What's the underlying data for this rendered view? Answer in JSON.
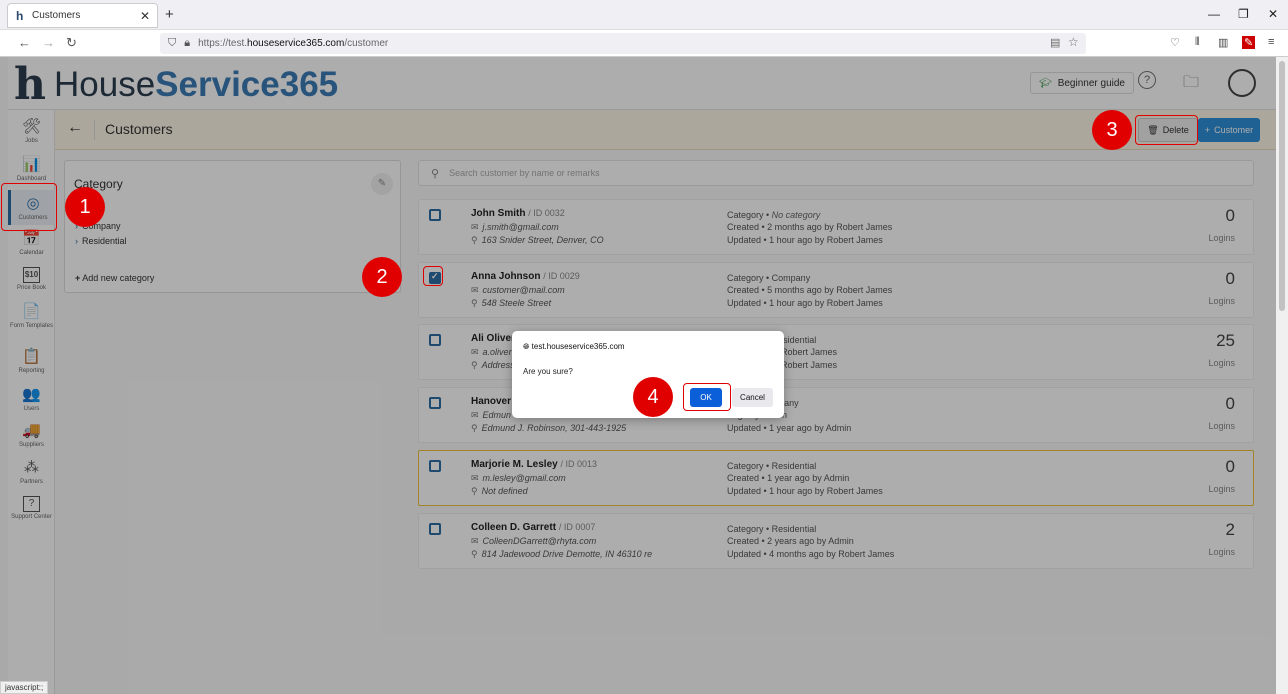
{
  "browser": {
    "tab_title": "Customers",
    "url_prefix": "https://test.",
    "url_domain": "houseservice365.com",
    "url_path": "/customer",
    "status_text": "javascript:;"
  },
  "header": {
    "logo_h": "h",
    "logo_a": "House",
    "logo_b": "Service365",
    "guide_label": "Beginner guide"
  },
  "sidebar": {
    "items": [
      {
        "label": "Jobs",
        "icon": "🛠"
      },
      {
        "label": "Dashboard",
        "icon": "📊"
      },
      {
        "label": "Customers",
        "icon": "◎"
      },
      {
        "label": "Calendar",
        "icon": "📅"
      },
      {
        "label": "Price Book",
        "icon": "$10"
      },
      {
        "label": "Form Templates",
        "icon": "📄"
      },
      {
        "label": "Reporting",
        "icon": "📋"
      },
      {
        "label": "Users",
        "icon": "👥"
      },
      {
        "label": "Suppliers",
        "icon": "🚚"
      },
      {
        "label": "Partners",
        "icon": "⁂"
      },
      {
        "label": "Support Center",
        "icon": "?"
      }
    ]
  },
  "subbar": {
    "title": "Customers",
    "delete_label": "Delete",
    "customer_label": "Customer"
  },
  "category": {
    "title": "Category",
    "items": [
      "Company",
      "Residential"
    ],
    "add_label": "Add new category"
  },
  "search": {
    "placeholder": "Search customer by name or remarks"
  },
  "customers": [
    {
      "name": "John Smith",
      "id": "/ ID 0032",
      "email": "j.smith@gmail.com",
      "address": "163 Snider Street, Denver, CO",
      "category": "No category",
      "created": "Created • 2 months ago by Robert James",
      "updated": "Updated • 1 hour ago by Robert James",
      "logins": "0",
      "checked": false
    },
    {
      "name": "Anna Johnson",
      "id": "/ ID 0029",
      "email": "customer@mail.com",
      "address": "548 Steele Street",
      "category": "Company",
      "created": "Created • 5 months ago by Robert James",
      "updated": "Updated • 1 hour ago by Robert James",
      "logins": "0",
      "checked": true
    },
    {
      "name": "Ali Oliver",
      "id": "",
      "email": "a.oliver",
      "address": "Address",
      "category": "Residential",
      "created": "onths ago by Robert James",
      "updated": "onths ago by Robert James",
      "logins": "25",
      "checked": false
    },
    {
      "name": "Hanover S",
      "id": "",
      "email": "Edmun",
      "address": "Edmund J. Robinson, 301-443-1925",
      "category": "mpany",
      "created": "r ago by Admin",
      "updated": "Updated • 1 year ago by Admin",
      "logins": "0",
      "checked": false
    },
    {
      "name": "Marjorie M. Lesley",
      "id": "/ ID 0013",
      "email": "m.lesley@gmail.com",
      "address": "Not defined",
      "category": "Residential",
      "created": "Created • 1 year ago by Admin",
      "updated": "Updated • 1 hour ago by Robert James",
      "logins": "0",
      "checked": false
    },
    {
      "name": "Colleen D. Garrett",
      "id": "/ ID 0007",
      "email": "ColleenDGarrett@rhyta.com",
      "address": "814 Jadewood Drive Demotte, IN 46310 re",
      "category": "Residential",
      "created": "Created • 2 years ago by Admin",
      "updated": "Updated • 4 months ago by Robert James",
      "logins": "2",
      "checked": false
    }
  ],
  "logins_label": "Logins",
  "category_prefix": "Category • ",
  "dialog": {
    "origin": "test.houseservice365.com",
    "message": "Are you sure?",
    "ok_label": "OK",
    "cancel_label": "Cancel"
  },
  "markers": [
    "1",
    "2",
    "3",
    "4"
  ],
  "colors": {
    "brand_dark": "#2c3e50",
    "brand_blue": "#3b7bb5",
    "primary_button": "#2f8fd8",
    "dialog_ok": "#0b5fd9",
    "marker_red": "#e00000",
    "subbar_bg": "#fdf6e6"
  }
}
